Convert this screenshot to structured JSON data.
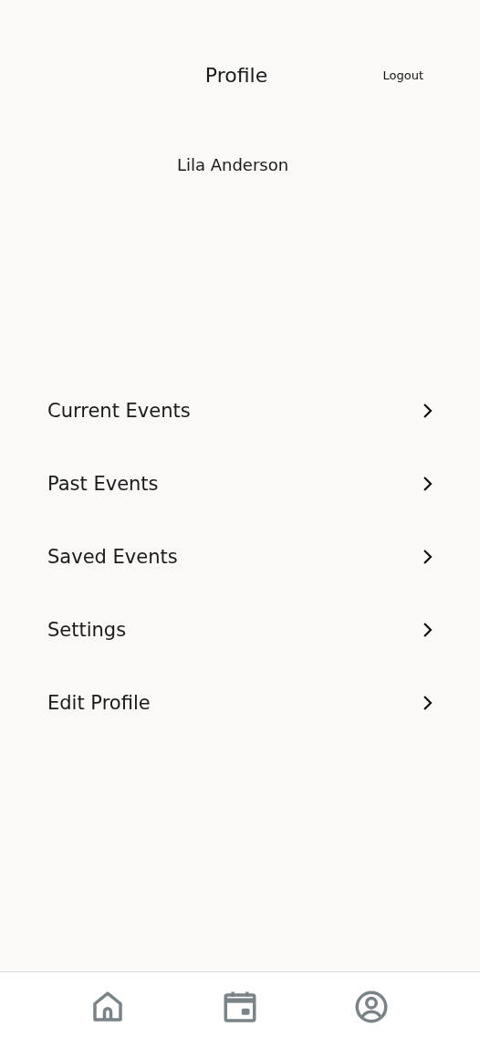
{
  "header": {
    "title": "Profile",
    "logout": "Logout"
  },
  "user": {
    "name": "Lila Anderson"
  },
  "menu": [
    {
      "label": "Current Events"
    },
    {
      "label": "Past Events"
    },
    {
      "label": "Saved Events"
    },
    {
      "label": "Settings"
    },
    {
      "label": "Edit Profile"
    }
  ],
  "nav": [
    {
      "kind": "home"
    },
    {
      "kind": "calendar"
    },
    {
      "kind": "profile"
    }
  ]
}
